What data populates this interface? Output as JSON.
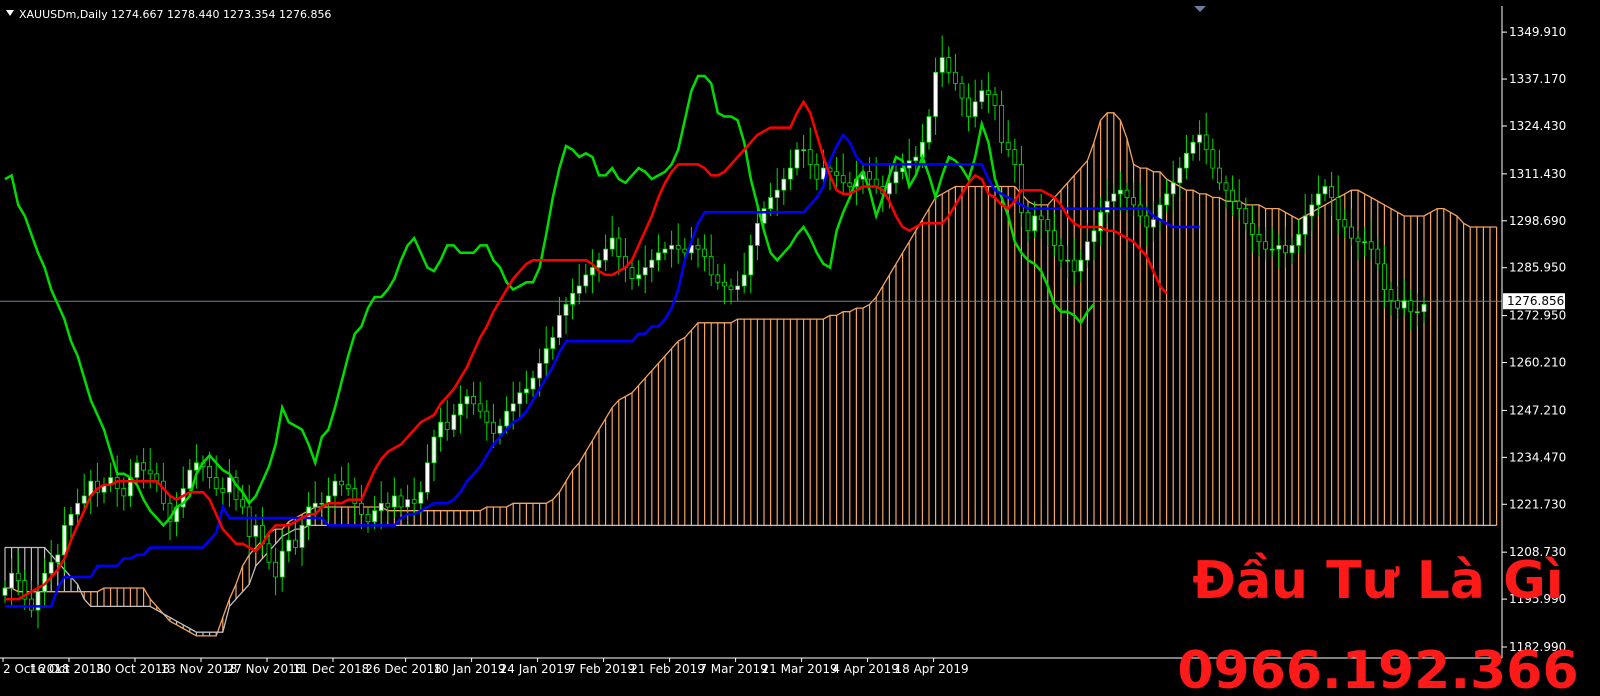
{
  "header": {
    "symbol": "XAUUSDm,Daily",
    "ohlc": "1274.667 1278.440 1273.354 1276.856"
  },
  "watermark": {
    "line1": "Đầu Tư Là Gì",
    "line2": "0966.192.366",
    "color": "#ff1a1a"
  },
  "colors": {
    "background": "#000000",
    "bull_candle": "#ffffff",
    "bear_candle": "#000000",
    "wick": "#00e000",
    "tenkan": "#ff0000",
    "kijun": "#0000ff",
    "chikou": "#00dd00",
    "cloud_bull": "#f4a460",
    "cloud_bear": "#c0c0c0",
    "price_line": "#708090"
  },
  "chart_data": {
    "type": "ichimoku-candlestick",
    "title": "XAUUSDm,Daily",
    "ylim": [
      1180,
      1357
    ],
    "last_price": 1276.856,
    "last_price_label": "1276.856",
    "y_ticks": [
      {
        "value": 1349.91,
        "label": "1349.910"
      },
      {
        "value": 1337.17,
        "label": "1337.170"
      },
      {
        "value": 1324.43,
        "label": "1324.430"
      },
      {
        "value": 1311.43,
        "label": "1311.430"
      },
      {
        "value": 1298.69,
        "label": "1298.690"
      },
      {
        "value": 1285.95,
        "label": "1285.950"
      },
      {
        "value": 1272.95,
        "label": "1272.950"
      },
      {
        "value": 1260.21,
        "label": "1260.210"
      },
      {
        "value": 1247.21,
        "label": "1247.210"
      },
      {
        "value": 1234.47,
        "label": "1234.470"
      },
      {
        "value": 1221.73,
        "label": "1221.730"
      },
      {
        "value": 1208.73,
        "label": "1208.730"
      },
      {
        "value": 1195.99,
        "label": "1195.990"
      },
      {
        "value": 1182.99,
        "label": "1182.990"
      }
    ],
    "x_ticks": [
      {
        "date": "2018-10-02",
        "label": "2 Oct 2018"
      },
      {
        "date": "2018-10-16",
        "label": "16 Oct 2018"
      },
      {
        "date": "2018-10-30",
        "label": "30 Oct 2018"
      },
      {
        "date": "2018-11-13",
        "label": "13 Nov 2018"
      },
      {
        "date": "2018-11-27",
        "label": "27 Nov 2018"
      },
      {
        "date": "2018-12-11",
        "label": "11 Dec 2018"
      },
      {
        "date": "2018-12-26",
        "label": "26 Dec 2018"
      },
      {
        "date": "2019-01-10",
        "label": "10 Jan 2019"
      },
      {
        "date": "2019-01-24",
        "label": "24 Jan 2019"
      },
      {
        "date": "2019-02-07",
        "label": "7 Feb 2019"
      },
      {
        "date": "2019-02-21",
        "label": "21 Feb 2019"
      },
      {
        "date": "2019-03-07",
        "label": "7 Mar 2019"
      },
      {
        "date": "2019-03-21",
        "label": "21 Mar 2019"
      },
      {
        "date": "2019-04-04",
        "label": "4 Apr 2019"
      },
      {
        "date": "2019-04-18",
        "label": "18 Apr 2019"
      }
    ],
    "close": [
      1199,
      1203,
      1201,
      1196,
      1193,
      1198,
      1203,
      1206,
      1208,
      1216,
      1219,
      1222,
      1224,
      1228,
      1225,
      1227,
      1229,
      1226,
      1224,
      1229,
      1233,
      1231,
      1230,
      1228,
      1222,
      1217,
      1221,
      1226,
      1231,
      1233,
      1232,
      1229,
      1226,
      1225,
      1229,
      1223,
      1221,
      1213,
      1216,
      1211,
      1206,
      1202,
      1209,
      1212,
      1210,
      1216,
      1221,
      1222,
      1222,
      1224,
      1228,
      1227,
      1226,
      1222,
      1219,
      1217,
      1220,
      1222,
      1221,
      1224,
      1221,
      1223,
      1222,
      1225,
      1233,
      1240,
      1244,
      1242,
      1246,
      1249,
      1251,
      1249,
      1247,
      1244,
      1241,
      1243,
      1247,
      1249,
      1252,
      1253,
      1256,
      1260,
      1264,
      1267,
      1273,
      1276,
      1279,
      1281,
      1284,
      1286,
      1288,
      1291,
      1294,
      1289,
      1286,
      1283,
      1284,
      1286,
      1288,
      1290,
      1291,
      1292,
      1291,
      1290,
      1292,
      1291,
      1289,
      1284,
      1282,
      1281,
      1280,
      1281,
      1284,
      1292,
      1298,
      1302,
      1305,
      1307,
      1310,
      1313,
      1318,
      1318,
      1314,
      1310,
      1313,
      1312,
      1311,
      1309,
      1308,
      1310,
      1312,
      1310,
      1308,
      1306,
      1309,
      1312,
      1313,
      1315,
      1316,
      1320,
      1327,
      1339,
      1343,
      1339,
      1336,
      1332,
      1327,
      1331,
      1334,
      1333,
      1330,
      1320,
      1318,
      1314,
      1301,
      1296,
      1300,
      1299,
      1296,
      1292,
      1288,
      1288,
      1285,
      1288,
      1293,
      1296,
      1301,
      1304,
      1306,
      1307,
      1305,
      1303,
      1300,
      1297,
      1299,
      1303,
      1306,
      1309,
      1313,
      1317,
      1320,
      1322,
      1318,
      1313,
      1309,
      1307,
      1304,
      1302,
      1298,
      1295,
      1293,
      1291,
      1291,
      1292,
      1290,
      1292,
      1295,
      1300,
      1303,
      1306,
      1308,
      1305,
      1299,
      1297,
      1294,
      1293,
      1293,
      1291,
      1287,
      1280,
      1277,
      1275,
      1277,
      1274,
      1274,
      1276
    ],
    "tenkan": [
      1196,
      1196,
      1196,
      1197,
      1198,
      1199,
      1200,
      1202,
      1204,
      1207,
      1212,
      1216,
      1220,
      1224,
      1226,
      1227,
      1227,
      1228,
      1228,
      1228,
      1228,
      1228,
      1228,
      1228,
      1226,
      1224,
      1223,
      1224,
      1225,
      1225,
      1225,
      1223,
      1219,
      1215,
      1213,
      1211,
      1211,
      1210,
      1209,
      1211,
      1214,
      1216,
      1216,
      1216,
      1217,
      1218,
      1219,
      1219,
      1221,
      1222,
      1222,
      1222,
      1223,
      1223,
      1223,
      1227,
      1231,
      1234,
      1236,
      1237,
      1238,
      1240,
      1242,
      1244,
      1245,
      1246,
      1249,
      1251,
      1253,
      1256,
      1259,
      1263,
      1267,
      1270,
      1274,
      1277,
      1280,
      1283,
      1285,
      1287,
      1288,
      1288,
      1288,
      1288,
      1288,
      1288,
      1288,
      1288,
      1288,
      1287,
      1285,
      1284,
      1284,
      1285,
      1286,
      1288,
      1292,
      1296,
      1300,
      1305,
      1309,
      1312,
      1314,
      1314,
      1314,
      1314,
      1313,
      1311,
      1311,
      1312,
      1314,
      1316,
      1318,
      1320,
      1322,
      1323,
      1324,
      1324,
      1324,
      1324,
      1328,
      1331,
      1328,
      1322,
      1316,
      1311,
      1307,
      1306,
      1306,
      1307,
      1308,
      1308,
      1308,
      1307,
      1304,
      1300,
      1297,
      1296,
      1297,
      1298,
      1298,
      1298,
      1298,
      1300,
      1303,
      1306,
      1309,
      1311,
      1310,
      1306,
      1305,
      1303,
      1302,
      1304,
      1307,
      1307,
      1307,
      1307,
      1306,
      1305,
      1303,
      1300,
      1298,
      1297,
      1297,
      1297,
      1297,
      1296,
      1296,
      1295,
      1294,
      1293,
      1291,
      1289,
      1285,
      1281,
      1279
    ],
    "kijun": [
      1194,
      1194,
      1194,
      1194,
      1194,
      1194,
      1194,
      1194,
      1199,
      1202,
      1202,
      1202,
      1202,
      1202,
      1205,
      1205,
      1205,
      1205,
      1207,
      1207,
      1208,
      1208,
      1210,
      1210,
      1210,
      1210,
      1210,
      1210,
      1210,
      1210,
      1210,
      1212,
      1214,
      1221,
      1218,
      1218,
      1218,
      1218,
      1218,
      1218,
      1218,
      1218,
      1218,
      1218,
      1218,
      1218,
      1218,
      1218,
      1218,
      1216,
      1216,
      1216,
      1216,
      1216,
      1216,
      1216,
      1216,
      1216,
      1216,
      1216,
      1218,
      1219,
      1219,
      1220,
      1221,
      1222,
      1222,
      1222,
      1223,
      1225,
      1228,
      1230,
      1232,
      1235,
      1238,
      1240,
      1242,
      1244,
      1245,
      1247,
      1250,
      1253,
      1256,
      1259,
      1263,
      1266,
      1266,
      1266,
      1266,
      1266,
      1266,
      1266,
      1266,
      1266,
      1266,
      1266,
      1268,
      1268,
      1270,
      1270,
      1272,
      1275,
      1280,
      1288,
      1293,
      1298,
      1301,
      1301,
      1301,
      1301,
      1301,
      1301,
      1301,
      1301,
      1301,
      1301,
      1301,
      1301,
      1301,
      1301,
      1301,
      1301,
      1303,
      1305,
      1308,
      1315,
      1319,
      1322,
      1320,
      1316,
      1314,
      1314,
      1314,
      1314,
      1314,
      1314,
      1314,
      1314,
      1314,
      1314,
      1314,
      1314,
      1314,
      1314,
      1314,
      1314,
      1314,
      1314,
      1314,
      1310,
      1307,
      1306,
      1305,
      1304,
      1303,
      1302,
      1302,
      1302,
      1302,
      1302,
      1302,
      1302,
      1302,
      1302,
      1302,
      1302,
      1302,
      1302,
      1302,
      1302,
      1302,
      1302,
      1302,
      1302,
      1300,
      1299,
      1298,
      1297,
      1297,
      1297,
      1297,
      1297
    ],
    "chikou": [
      1310,
      1311,
      1303,
      1300,
      1295,
      1290,
      1286,
      1280,
      1276,
      1272,
      1266,
      1262,
      1256,
      1250,
      1246,
      1242,
      1236,
      1230,
      1230,
      1229,
      1227,
      1223,
      1220,
      1218,
      1216,
      1218,
      1221,
      1222,
      1224,
      1230,
      1233,
      1235,
      1233,
      1231,
      1230,
      1227,
      1225,
      1222,
      1224,
      1228,
      1232,
      1238,
      1248,
      1244,
      1243,
      1242,
      1238,
      1233,
      1240,
      1242,
      1248,
      1255,
      1262,
      1268,
      1270,
      1275,
      1278,
      1278,
      1280,
      1283,
      1288,
      1292,
      1294,
      1290,
      1286,
      1285,
      1288,
      1292,
      1292,
      1290,
      1290,
      1290,
      1292,
      1292,
      1288,
      1286,
      1282,
      1280,
      1281,
      1282,
      1282,
      1286,
      1295,
      1305,
      1313,
      1319,
      1318,
      1316,
      1317,
      1316,
      1311,
      1311,
      1313,
      1310,
      1309,
      1311,
      1313,
      1312,
      1310,
      1311,
      1312,
      1314,
      1318,
      1326,
      1334,
      1338,
      1338,
      1336,
      1328,
      1327,
      1327,
      1326,
      1320,
      1310,
      1303,
      1296,
      1290,
      1288,
      1290,
      1292,
      1295,
      1297,
      1294,
      1290,
      1287,
      1286,
      1296,
      1301,
      1305,
      1310,
      1312,
      1307,
      1300,
      1305,
      1311,
      1316,
      1315,
      1308,
      1311,
      1316,
      1311,
      1305,
      1311,
      1316,
      1315,
      1313,
      1310,
      1316,
      1325,
      1320,
      1310,
      1305,
      1300,
      1293,
      1290,
      1288,
      1287,
      1285,
      1281,
      1276,
      1274,
      1274,
      1273,
      1271,
      1274,
      1276
    ],
    "span_a": [
      1199,
      1199,
      1198,
      1198,
      1198,
      1198,
      1198,
      1198,
      1198,
      1198,
      1198,
      1198,
      1198,
      1198,
      1198,
      1199,
      1199,
      1199,
      1199,
      1199,
      1199,
      1199,
      1196,
      1194,
      1192,
      1190,
      1189,
      1188,
      1187,
      1186,
      1186,
      1186,
      1186,
      1191,
      1196,
      1200,
      1205,
      1208,
      1210,
      1212,
      1214,
      1215,
      1215,
      1217,
      1218,
      1219,
      1220,
      1221,
      1221,
      1221,
      1221,
      1221,
      1221,
      1221,
      1221,
      1221,
      1221,
      1221,
      1220,
      1220,
      1220,
      1220,
      1220,
      1220,
      1220,
      1220,
      1220,
      1220,
      1220,
      1220,
      1220,
      1220,
      1220,
      1221,
      1221,
      1221,
      1221,
      1222,
      1222,
      1222,
      1222,
      1222,
      1222,
      1223,
      1225,
      1228,
      1231,
      1233,
      1236,
      1239,
      1242,
      1245,
      1248,
      1250,
      1251,
      1252,
      1254,
      1256,
      1258,
      1260,
      1262,
      1264,
      1266,
      1267,
      1269,
      1271,
      1271,
      1271,
      1271,
      1271,
      1271,
      1272,
      1272,
      1272,
      1272,
      1272,
      1272,
      1272,
      1272,
      1272,
      1272,
      1272,
      1272,
      1272,
      1272,
      1273,
      1273,
      1274,
      1274,
      1275,
      1275,
      1276,
      1278,
      1281,
      1284,
      1287,
      1290,
      1293,
      1296,
      1299,
      1302,
      1305,
      1306,
      1307,
      1308,
      1308,
      1308,
      1308,
      1308,
      1308,
      1308,
      1308,
      1308,
      1308,
      1306,
      1304,
      1303,
      1303,
      1303,
      1305,
      1307,
      1309,
      1311,
      1313,
      1315,
      1320,
      1326,
      1328,
      1328,
      1326,
      1321,
      1314,
      1313,
      1313,
      1312,
      1312,
      1310,
      1309,
      1308,
      1307,
      1307,
      1306,
      1306,
      1305,
      1305,
      1304,
      1304,
      1304,
      1303,
      1303,
      1303,
      1302,
      1302,
      1302,
      1301,
      1300,
      1299,
      1300,
      1301,
      1302,
      1303,
      1304,
      1305,
      1306,
      1307,
      1307,
      1306,
      1305,
      1304,
      1303,
      1302,
      1301,
      1300,
      1300,
      1300,
      1300,
      1301,
      1302,
      1302,
      1301,
      1300,
      1298,
      1297,
      1297,
      1297,
      1297,
      1297
    ],
    "span_b": [
      1210,
      1210,
      1210,
      1210,
      1210,
      1210,
      1210,
      1208,
      1206,
      1204,
      1202,
      1200,
      1196,
      1194,
      1194,
      1194,
      1194,
      1194,
      1194,
      1194,
      1194,
      1194,
      1194,
      1193,
      1192,
      1191,
      1190,
      1189,
      1188,
      1187,
      1187,
      1187,
      1187,
      1187,
      1194,
      1196,
      1198,
      1200,
      1205,
      1207,
      1209,
      1211,
      1213,
      1214,
      1215,
      1215,
      1216,
      1216,
      1216,
      1216,
      1216,
      1216,
      1216,
      1216,
      1216,
      1216,
      1216,
      1216,
      1216,
      1216,
      1216,
      1216,
      1216,
      1216,
      1216,
      1216,
      1216,
      1216,
      1216,
      1216,
      1216,
      1216,
      1216,
      1216,
      1216,
      1216,
      1216,
      1216,
      1216,
      1216,
      1216,
      1216,
      1216,
      1216,
      1216,
      1216,
      1216,
      1216,
      1216,
      1216,
      1216,
      1216,
      1216,
      1216,
      1216,
      1216,
      1216,
      1216,
      1216,
      1216,
      1216,
      1216,
      1216,
      1216,
      1216,
      1216,
      1216,
      1216,
      1216,
      1216,
      1216,
      1216,
      1216,
      1216,
      1216,
      1216,
      1216,
      1216,
      1216,
      1216,
      1216,
      1216,
      1216,
      1216,
      1216,
      1216,
      1216,
      1216,
      1216,
      1216,
      1216,
      1216,
      1216,
      1216,
      1216,
      1216,
      1216,
      1216,
      1216,
      1216,
      1216,
      1216,
      1216,
      1216,
      1216,
      1216,
      1216,
      1216,
      1216,
      1216,
      1216,
      1216,
      1216,
      1216,
      1216,
      1216,
      1216,
      1216,
      1216,
      1216,
      1216,
      1216,
      1216,
      1216,
      1216,
      1216,
      1216,
      1216,
      1216,
      1216,
      1216,
      1216,
      1216,
      1216,
      1216,
      1216,
      1216,
      1216,
      1216,
      1216,
      1216,
      1216,
      1216,
      1216,
      1216,
      1216,
      1216,
      1216,
      1216,
      1216,
      1216,
      1216,
      1216,
      1216,
      1216,
      1216,
      1216,
      1216,
      1216,
      1216,
      1216,
      1216,
      1216,
      1216,
      1216,
      1216,
      1216,
      1216,
      1216,
      1216,
      1216,
      1216,
      1216,
      1216,
      1216,
      1216,
      1216,
      1216,
      1216,
      1216,
      1216,
      1216,
      1216,
      1216,
      1216,
      1216,
      1216,
      1216,
      1216,
      1216,
      1216,
      1216,
      1216,
      1216,
      1216,
      1216
    ]
  }
}
